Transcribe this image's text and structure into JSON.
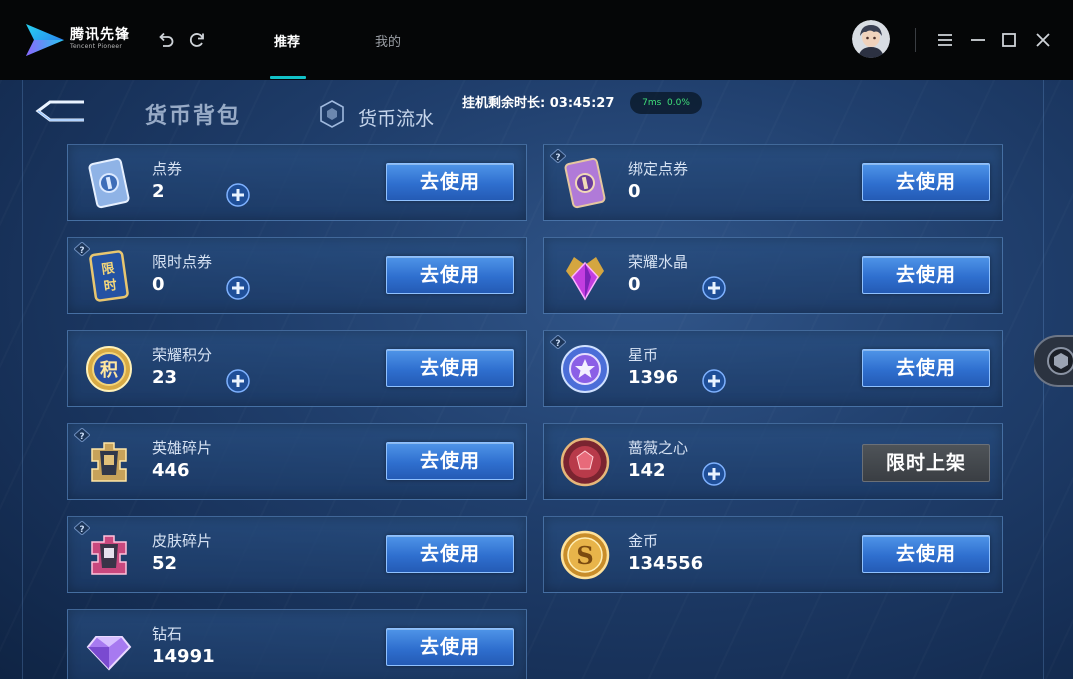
{
  "app": {
    "logo_cn": "腾讯先锋",
    "logo_en": "Tencent Pioneer"
  },
  "titlebar": {
    "tabs": [
      {
        "label": "推荐",
        "active": true
      },
      {
        "label": "我的",
        "active": false
      }
    ],
    "icons": [
      "undo-icon",
      "refresh-icon",
      "menu-icon",
      "minimize-icon",
      "maximize-icon",
      "close-icon"
    ],
    "accent": "#12c2c8"
  },
  "game": {
    "header_title": "货币背包",
    "flow_label": "货币流水",
    "timer_text": "挂机剩余时长: 03:45:27",
    "net_ping": "7ms",
    "net_loss": "0.0%",
    "use_label": "去使用",
    "limited_label": "限时上架",
    "currencies": [
      {
        "name": "点券",
        "value": "2",
        "icon": "voucher-icon",
        "plus": true,
        "help": false,
        "action": "use"
      },
      {
        "name": "绑定点券",
        "value": "0",
        "icon": "bound-voucher-icon",
        "plus": false,
        "help": true,
        "action": "use"
      },
      {
        "name": "限时点券",
        "value": "0",
        "icon": "limited-voucher-icon",
        "plus": true,
        "help": true,
        "action": "use"
      },
      {
        "name": "荣耀水晶",
        "value": "0",
        "icon": "glory-crystal-icon",
        "plus": true,
        "help": false,
        "action": "use"
      },
      {
        "name": "荣耀积分",
        "value": "23",
        "icon": "glory-points-icon",
        "plus": true,
        "help": false,
        "action": "use"
      },
      {
        "name": "星币",
        "value": "1396",
        "icon": "star-coin-icon",
        "plus": true,
        "help": true,
        "action": "use"
      },
      {
        "name": "英雄碎片",
        "value": "446",
        "icon": "hero-shard-icon",
        "plus": false,
        "help": true,
        "action": "use"
      },
      {
        "name": "蔷薇之心",
        "value": "142",
        "icon": "rose-heart-icon",
        "plus": true,
        "help": false,
        "action": "limited"
      },
      {
        "name": "皮肤碎片",
        "value": "52",
        "icon": "skin-shard-icon",
        "plus": false,
        "help": true,
        "action": "use"
      },
      {
        "name": "金币",
        "value": "134556",
        "icon": "gold-coin-icon",
        "plus": false,
        "help": false,
        "action": "use"
      },
      {
        "name": "钻石",
        "value": "14991",
        "icon": "diamond-icon",
        "plus": false,
        "help": false,
        "action": "use"
      }
    ]
  }
}
